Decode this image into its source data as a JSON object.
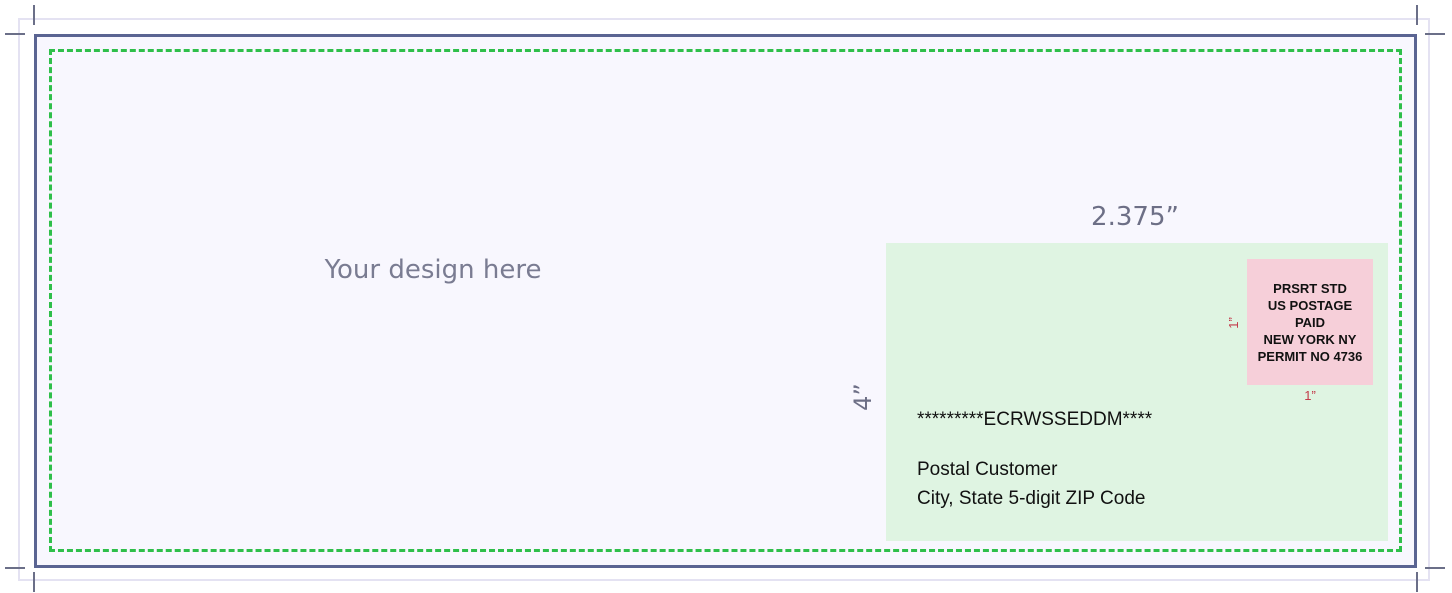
{
  "placeholder": {
    "text": "Your design here"
  },
  "dimensions": {
    "address_width": "2.375”",
    "address_height": "4”",
    "indicia_width": "1”",
    "indicia_height": "1”"
  },
  "address_block": {
    "endorsement": "*********ECRWSSEDDM****",
    "recipient_line1": "Postal Customer",
    "recipient_line2": "City, State 5-digit ZIP Code"
  },
  "indicia": {
    "lines": [
      "PRSRT STD",
      "US POSTAGE",
      "PAID",
      "NEW YORK NY",
      "PERMIT NO 4736"
    ]
  },
  "colors": {
    "trim_line": "#5a6492",
    "safe_zone": "#2fbf4a",
    "address_area": "#dff4e2",
    "indicia_area": "#f6cfd9",
    "indicia_dimension_text": "#c33a4a"
  }
}
